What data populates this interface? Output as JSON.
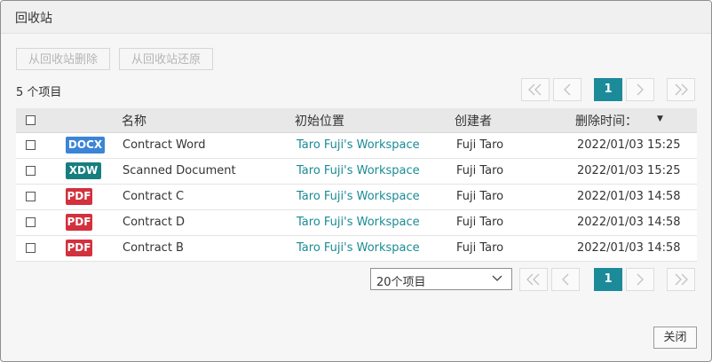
{
  "dialog": {
    "title": "回收站",
    "delete_button": "从回收站删除",
    "restore_button": "从回收站还原",
    "item_count": "5 个项目",
    "close_button": "关闭"
  },
  "pager": {
    "first": "«",
    "prev": "‹",
    "current_page": "1",
    "next": "›",
    "last": "»",
    "page_size": "20个项目"
  },
  "table": {
    "columns": {
      "name": "名称",
      "location": "初始位置",
      "creator": "创建者",
      "deleted_time": "删除时间："
    },
    "rows": [
      {
        "type": "DOCX",
        "type_color": "#3b84d6",
        "name": "Contract Word",
        "location": "Taro Fuji's Workspace",
        "creator": "Fuji Taro",
        "deleted": "2022/01/03 15:25"
      },
      {
        "type": "XDW",
        "type_color": "#177e7f",
        "name": "Scanned Document",
        "location": "Taro Fuji's Workspace",
        "creator": "Fuji Taro",
        "deleted": "2022/01/03 15:25"
      },
      {
        "type": "PDF",
        "type_color": "#d2313d",
        "name": "Contract C",
        "location": "Taro Fuji's Workspace",
        "creator": "Fuji Taro",
        "deleted": "2022/01/03 14:58"
      },
      {
        "type": "PDF",
        "type_color": "#d2313d",
        "name": "Contract D",
        "location": "Taro Fuji's Workspace",
        "creator": "Fuji Taro",
        "deleted": "2022/01/03 14:58"
      },
      {
        "type": "PDF",
        "type_color": "#d2313d",
        "name": "Contract B",
        "location": "Taro Fuji's Workspace",
        "creator": "Fuji Taro",
        "deleted": "2022/01/03 14:58"
      }
    ]
  }
}
